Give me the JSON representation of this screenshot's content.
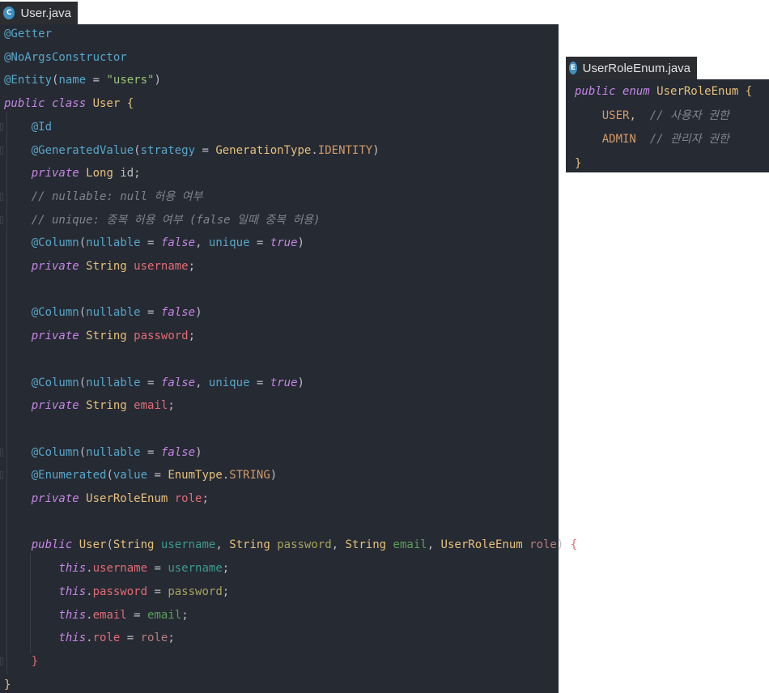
{
  "tabs": [
    {
      "label": "User.java",
      "icon": "class-icon",
      "badge": "C"
    },
    {
      "label": "UserRoleEnum.java",
      "icon": "enum-icon",
      "badge": "E"
    }
  ],
  "user_java": {
    "lines": [
      [
        {
          "t": "@Getter",
          "c": "ann"
        }
      ],
      [
        {
          "t": "@NoArgsConstructor",
          "c": "ann"
        }
      ],
      [
        {
          "t": "@Entity",
          "c": "ann"
        },
        {
          "t": "(",
          "c": "pn"
        },
        {
          "t": "name",
          "c": "ann"
        },
        {
          "t": " = ",
          "c": "pn"
        },
        {
          "t": "\"users\"",
          "c": "str"
        },
        {
          "t": ")",
          "c": "pn"
        }
      ],
      [
        {
          "t": "public class ",
          "c": "kw"
        },
        {
          "t": "User",
          "c": "ty"
        },
        {
          "t": " {",
          "c": "br1"
        }
      ],
      [
        {
          "t": "    ",
          "c": "pn"
        },
        {
          "t": "@Id",
          "c": "ann"
        }
      ],
      [
        {
          "t": "    ",
          "c": "pn"
        },
        {
          "t": "@GeneratedValue",
          "c": "ann"
        },
        {
          "t": "(",
          "c": "pn"
        },
        {
          "t": "strategy",
          "c": "ann"
        },
        {
          "t": " = ",
          "c": "pn"
        },
        {
          "t": "GenerationType",
          "c": "ty"
        },
        {
          "t": ".",
          "c": "pn"
        },
        {
          "t": "IDENTITY",
          "c": "con"
        },
        {
          "t": ")",
          "c": "pn"
        }
      ],
      [
        {
          "t": "    ",
          "c": "pn"
        },
        {
          "t": "private ",
          "c": "kw"
        },
        {
          "t": "Long",
          "c": "ty"
        },
        {
          "t": " id;",
          "c": "pn"
        }
      ],
      [
        {
          "t": "    ",
          "c": "pn"
        },
        {
          "t": "// nullable: null 허용 여부",
          "c": "cmt"
        }
      ],
      [
        {
          "t": "    ",
          "c": "pn"
        },
        {
          "t": "// unique: 중복 허용 여부 (false 일때 중복 허용)",
          "c": "cmt"
        }
      ],
      [
        {
          "t": "    ",
          "c": "pn"
        },
        {
          "t": "@Column",
          "c": "ann"
        },
        {
          "t": "(",
          "c": "pn"
        },
        {
          "t": "nullable",
          "c": "ann"
        },
        {
          "t": " = ",
          "c": "pn"
        },
        {
          "t": "false",
          "c": "kw"
        },
        {
          "t": ", ",
          "c": "pn"
        },
        {
          "t": "unique",
          "c": "ann"
        },
        {
          "t": " = ",
          "c": "pn"
        },
        {
          "t": "true",
          "c": "kw"
        },
        {
          "t": ")",
          "c": "pn"
        }
      ],
      [
        {
          "t": "    ",
          "c": "pn"
        },
        {
          "t": "private ",
          "c": "kw"
        },
        {
          "t": "String",
          "c": "ty"
        },
        {
          "t": " ",
          "c": "pn"
        },
        {
          "t": "username",
          "c": "fld"
        },
        {
          "t": ";",
          "c": "pn"
        }
      ],
      [],
      [
        {
          "t": "    ",
          "c": "pn"
        },
        {
          "t": "@Column",
          "c": "ann"
        },
        {
          "t": "(",
          "c": "pn"
        },
        {
          "t": "nullable",
          "c": "ann"
        },
        {
          "t": " = ",
          "c": "pn"
        },
        {
          "t": "false",
          "c": "kw"
        },
        {
          "t": ")",
          "c": "pn"
        }
      ],
      [
        {
          "t": "    ",
          "c": "pn"
        },
        {
          "t": "private ",
          "c": "kw"
        },
        {
          "t": "String",
          "c": "ty"
        },
        {
          "t": " ",
          "c": "pn"
        },
        {
          "t": "password",
          "c": "fld"
        },
        {
          "t": ";",
          "c": "pn"
        }
      ],
      [],
      [
        {
          "t": "    ",
          "c": "pn"
        },
        {
          "t": "@Column",
          "c": "ann"
        },
        {
          "t": "(",
          "c": "pn"
        },
        {
          "t": "nullable",
          "c": "ann"
        },
        {
          "t": " = ",
          "c": "pn"
        },
        {
          "t": "false",
          "c": "kw"
        },
        {
          "t": ", ",
          "c": "pn"
        },
        {
          "t": "unique",
          "c": "ann"
        },
        {
          "t": " = ",
          "c": "pn"
        },
        {
          "t": "true",
          "c": "kw"
        },
        {
          "t": ")",
          "c": "pn"
        }
      ],
      [
        {
          "t": "    ",
          "c": "pn"
        },
        {
          "t": "private ",
          "c": "kw"
        },
        {
          "t": "String",
          "c": "ty"
        },
        {
          "t": " ",
          "c": "pn"
        },
        {
          "t": "email",
          "c": "fld"
        },
        {
          "t": ";",
          "c": "pn"
        }
      ],
      [],
      [
        {
          "t": "    ",
          "c": "pn"
        },
        {
          "t": "@Column",
          "c": "ann"
        },
        {
          "t": "(",
          "c": "pn"
        },
        {
          "t": "nullable",
          "c": "ann"
        },
        {
          "t": " = ",
          "c": "pn"
        },
        {
          "t": "false",
          "c": "kw"
        },
        {
          "t": ")",
          "c": "pn"
        }
      ],
      [
        {
          "t": "    ",
          "c": "pn"
        },
        {
          "t": "@Enumerated",
          "c": "ann"
        },
        {
          "t": "(",
          "c": "pn"
        },
        {
          "t": "value",
          "c": "ann"
        },
        {
          "t": " = ",
          "c": "pn"
        },
        {
          "t": "EnumType",
          "c": "ty"
        },
        {
          "t": ".",
          "c": "pn"
        },
        {
          "t": "STRING",
          "c": "con"
        },
        {
          "t": ")",
          "c": "pn"
        }
      ],
      [
        {
          "t": "    ",
          "c": "pn"
        },
        {
          "t": "private ",
          "c": "kw"
        },
        {
          "t": "UserRoleEnum",
          "c": "ty"
        },
        {
          "t": " ",
          "c": "pn"
        },
        {
          "t": "role",
          "c": "fld"
        },
        {
          "t": ";",
          "c": "pn"
        }
      ],
      [],
      [
        {
          "t": "    ",
          "c": "pn"
        },
        {
          "t": "public ",
          "c": "kw"
        },
        {
          "t": "User",
          "c": "ty"
        },
        {
          "t": "(",
          "c": "pn"
        },
        {
          "t": "String",
          "c": "ty"
        },
        {
          "t": " ",
          "c": "pn"
        },
        {
          "t": "username",
          "c": "g1"
        },
        {
          "t": ", ",
          "c": "pn"
        },
        {
          "t": "String",
          "c": "ty"
        },
        {
          "t": " ",
          "c": "pn"
        },
        {
          "t": "password",
          "c": "g2"
        },
        {
          "t": ", ",
          "c": "pn"
        },
        {
          "t": "String",
          "c": "ty"
        },
        {
          "t": " ",
          "c": "pn"
        },
        {
          "t": "email",
          "c": "g3"
        },
        {
          "t": ", ",
          "c": "pn"
        },
        {
          "t": "UserRoleEnum",
          "c": "ty"
        },
        {
          "t": " ",
          "c": "pn"
        },
        {
          "t": "role",
          "c": "g4"
        },
        {
          "t": ") ",
          "c": "pn"
        },
        {
          "t": "{",
          "c": "br2"
        }
      ],
      [
        {
          "t": "        ",
          "c": "pn"
        },
        {
          "t": "this",
          "c": "kw"
        },
        {
          "t": ".",
          "c": "pn"
        },
        {
          "t": "username",
          "c": "fld"
        },
        {
          "t": " = ",
          "c": "pn"
        },
        {
          "t": "username",
          "c": "g1"
        },
        {
          "t": ";",
          "c": "pn"
        }
      ],
      [
        {
          "t": "        ",
          "c": "pn"
        },
        {
          "t": "this",
          "c": "kw"
        },
        {
          "t": ".",
          "c": "pn"
        },
        {
          "t": "password",
          "c": "fld"
        },
        {
          "t": " = ",
          "c": "pn"
        },
        {
          "t": "password",
          "c": "g2"
        },
        {
          "t": ";",
          "c": "pn"
        }
      ],
      [
        {
          "t": "        ",
          "c": "pn"
        },
        {
          "t": "this",
          "c": "kw"
        },
        {
          "t": ".",
          "c": "pn"
        },
        {
          "t": "email",
          "c": "fld"
        },
        {
          "t": " = ",
          "c": "pn"
        },
        {
          "t": "email",
          "c": "g3"
        },
        {
          "t": ";",
          "c": "pn"
        }
      ],
      [
        {
          "t": "        ",
          "c": "pn"
        },
        {
          "t": "this",
          "c": "kw"
        },
        {
          "t": ".",
          "c": "pn"
        },
        {
          "t": "role",
          "c": "fld"
        },
        {
          "t": " = ",
          "c": "pn"
        },
        {
          "t": "role",
          "c": "g4"
        },
        {
          "t": ";",
          "c": "pn"
        }
      ],
      [
        {
          "t": "    ",
          "c": "pn"
        },
        {
          "t": "}",
          "c": "br2"
        }
      ],
      [
        {
          "t": "}",
          "c": "br1"
        }
      ]
    ]
  },
  "user_role_enum_java": {
    "lines": [
      [
        {
          "t": "public enum ",
          "c": "kw"
        },
        {
          "t": "UserRoleEnum",
          "c": "ty"
        },
        {
          "t": " {",
          "c": "br1"
        }
      ],
      [
        {
          "t": "    ",
          "c": "pn"
        },
        {
          "t": "USER",
          "c": "con"
        },
        {
          "t": ",  ",
          "c": "pn"
        },
        {
          "t": "// 사용자 권한",
          "c": "cmt"
        }
      ],
      [
        {
          "t": "    ",
          "c": "pn"
        },
        {
          "t": "ADMIN",
          "c": "con"
        },
        {
          "t": "  ",
          "c": "pn"
        },
        {
          "t": "// 관리자 권한",
          "c": "cmt"
        }
      ],
      [
        {
          "t": "}",
          "c": "br1"
        }
      ]
    ]
  }
}
